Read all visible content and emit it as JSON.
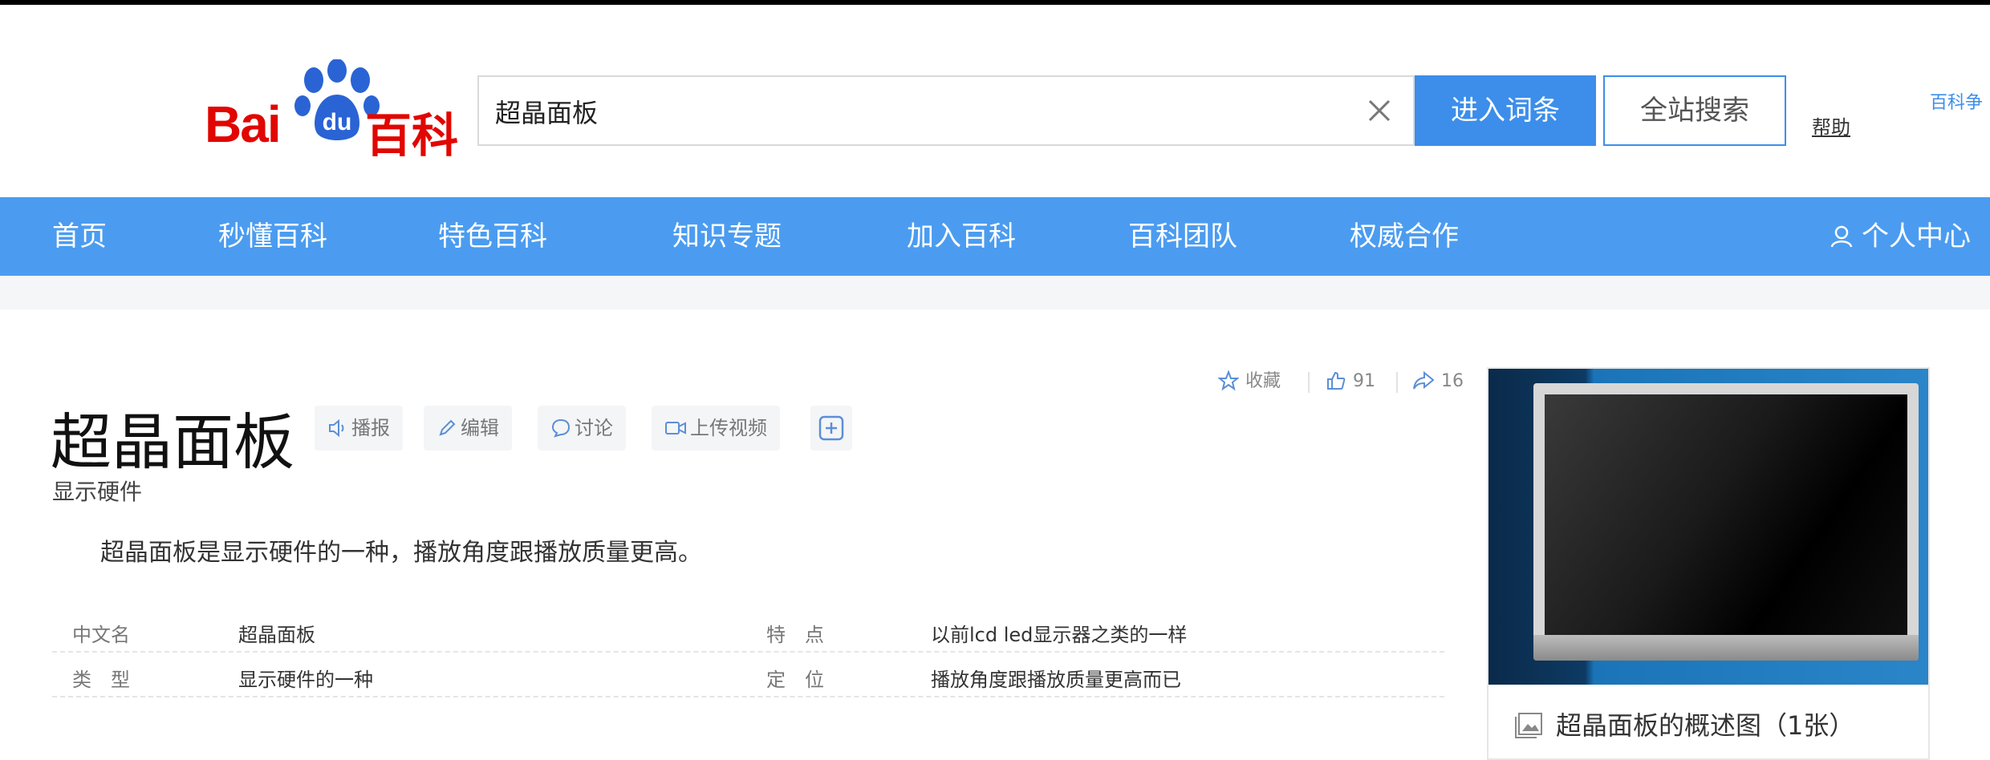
{
  "logo": {
    "latin": "Bai",
    "paw": "du",
    "cn": "百科"
  },
  "search": {
    "value": "超晶面板",
    "enter_label": "进入词条",
    "site_label": "全站搜索",
    "help_label": "帮助",
    "extra_link": "百科争"
  },
  "nav": {
    "items": [
      "首页",
      "秒懂百科",
      "特色百科",
      "知识专题",
      "加入百科",
      "百科团队",
      "权威合作"
    ],
    "user_center": "个人中心"
  },
  "entry": {
    "title": "超晶面板",
    "tools": [
      "播报",
      "编辑",
      "讨论",
      "上传视频"
    ],
    "subtitle": "显示硬件",
    "summary": "超晶面板是显示硬件的一种，播放角度跟播放质量更高。",
    "actions": {
      "favorite": "收藏",
      "likes": "91",
      "shares": "16"
    },
    "infobox": [
      {
        "label1": "中文名",
        "value1": "超晶面板",
        "label2": "特　点",
        "value2": "以前lcd led显示器之类的一样"
      },
      {
        "label1": "类　型",
        "value1": "显示硬件的一种",
        "label2": "定　位",
        "value2": "播放角度跟播放质量更高而已"
      }
    ],
    "image_caption": "超晶面板的概述图（1张）"
  },
  "colors": {
    "brand_red": "#e10601",
    "accent_blue": "#3c8eea",
    "nav_blue": "#4b9cf0"
  }
}
